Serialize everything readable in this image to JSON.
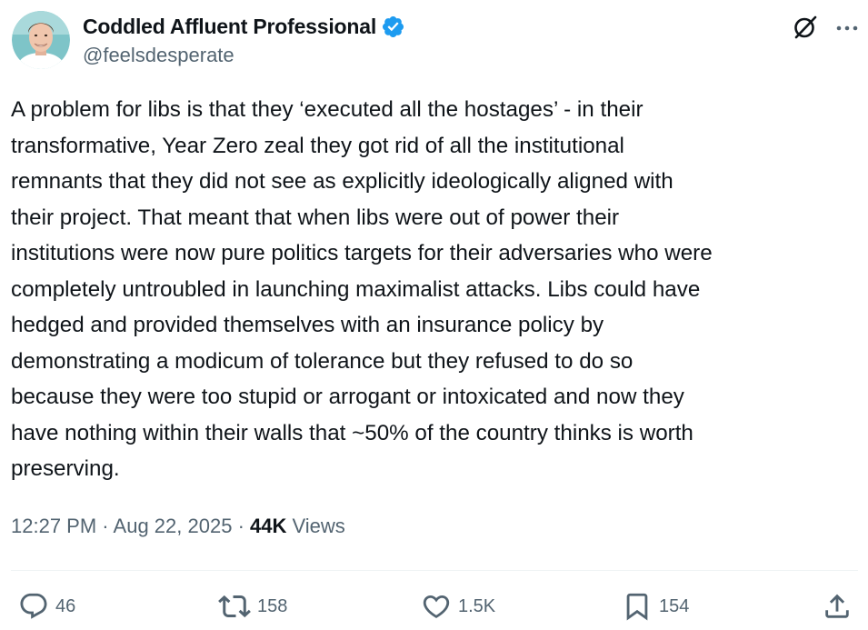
{
  "author": {
    "display_name": "Coddled Affluent Professional",
    "handle": "@feelsdesperate",
    "verified": true
  },
  "header_icons": [
    "grok-icon",
    "more-icon"
  ],
  "post": {
    "text": "A problem for libs is that they ‘executed all the hostages’ - in their\ntransformative, Year Zero zeal they got rid of all the institutional\nremnants that they did not see as explicitly ideologically aligned with\ntheir project. That meant that when libs were out of power their\ninstitutions were now pure politics targets for their adversaries who were\ncompletely untroubled in launching maximalist attacks. Libs could have\nhedged and provided themselves with an insurance policy by\ndemonstrating a modicum of tolerance but they refused to do so\nbecause they were too stupid or arrogant or intoxicated and now they\nhave nothing within their walls that ~50% of the country thinks is worth\npreserving."
  },
  "meta": {
    "time": "12:27 PM",
    "separator": "·",
    "date": "Aug 22, 2025",
    "views_count": "44K",
    "views_label": "Views"
  },
  "actions": {
    "replies": "46",
    "reposts": "158",
    "likes": "1.5K",
    "bookmarks": "154"
  },
  "colors": {
    "text": "#0f1419",
    "secondary": "#536471",
    "verified_badge": "#1d9bf0",
    "divider": "#eff3f4"
  }
}
